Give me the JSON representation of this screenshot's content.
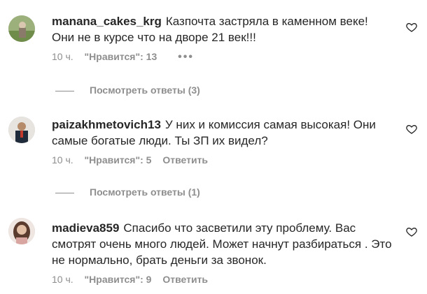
{
  "comments": [
    {
      "username": "manana_cakes_krg",
      "text": "Казпочта застряла в каменном веке! Они не в курсе что на дворе 21 век!!!",
      "time": "10 ч.",
      "likes": "\"Нравится\": 13",
      "more": "•••",
      "replies": "Посмотреть ответы (3)"
    },
    {
      "username": "paizakhmetovich13",
      "text": "У них и комиссия самая высокая! Они самые богатые люди. Ты ЗП их видел?",
      "time": "10 ч.",
      "likes": "\"Нравится\": 5",
      "reply": "Ответить",
      "replies": "Посмотреть ответы (1)"
    },
    {
      "username": "madieva859",
      "text": "Спасибо что засветили эту проблему. Вас смотрят очень много людей. Может начнут разбираться . Это не нормально, брать деньги за звонок.",
      "time": "10 ч.",
      "likes": "\"Нравится\": 9",
      "reply": "Ответить"
    }
  ],
  "icons": {
    "like": "heart-outline-icon"
  }
}
